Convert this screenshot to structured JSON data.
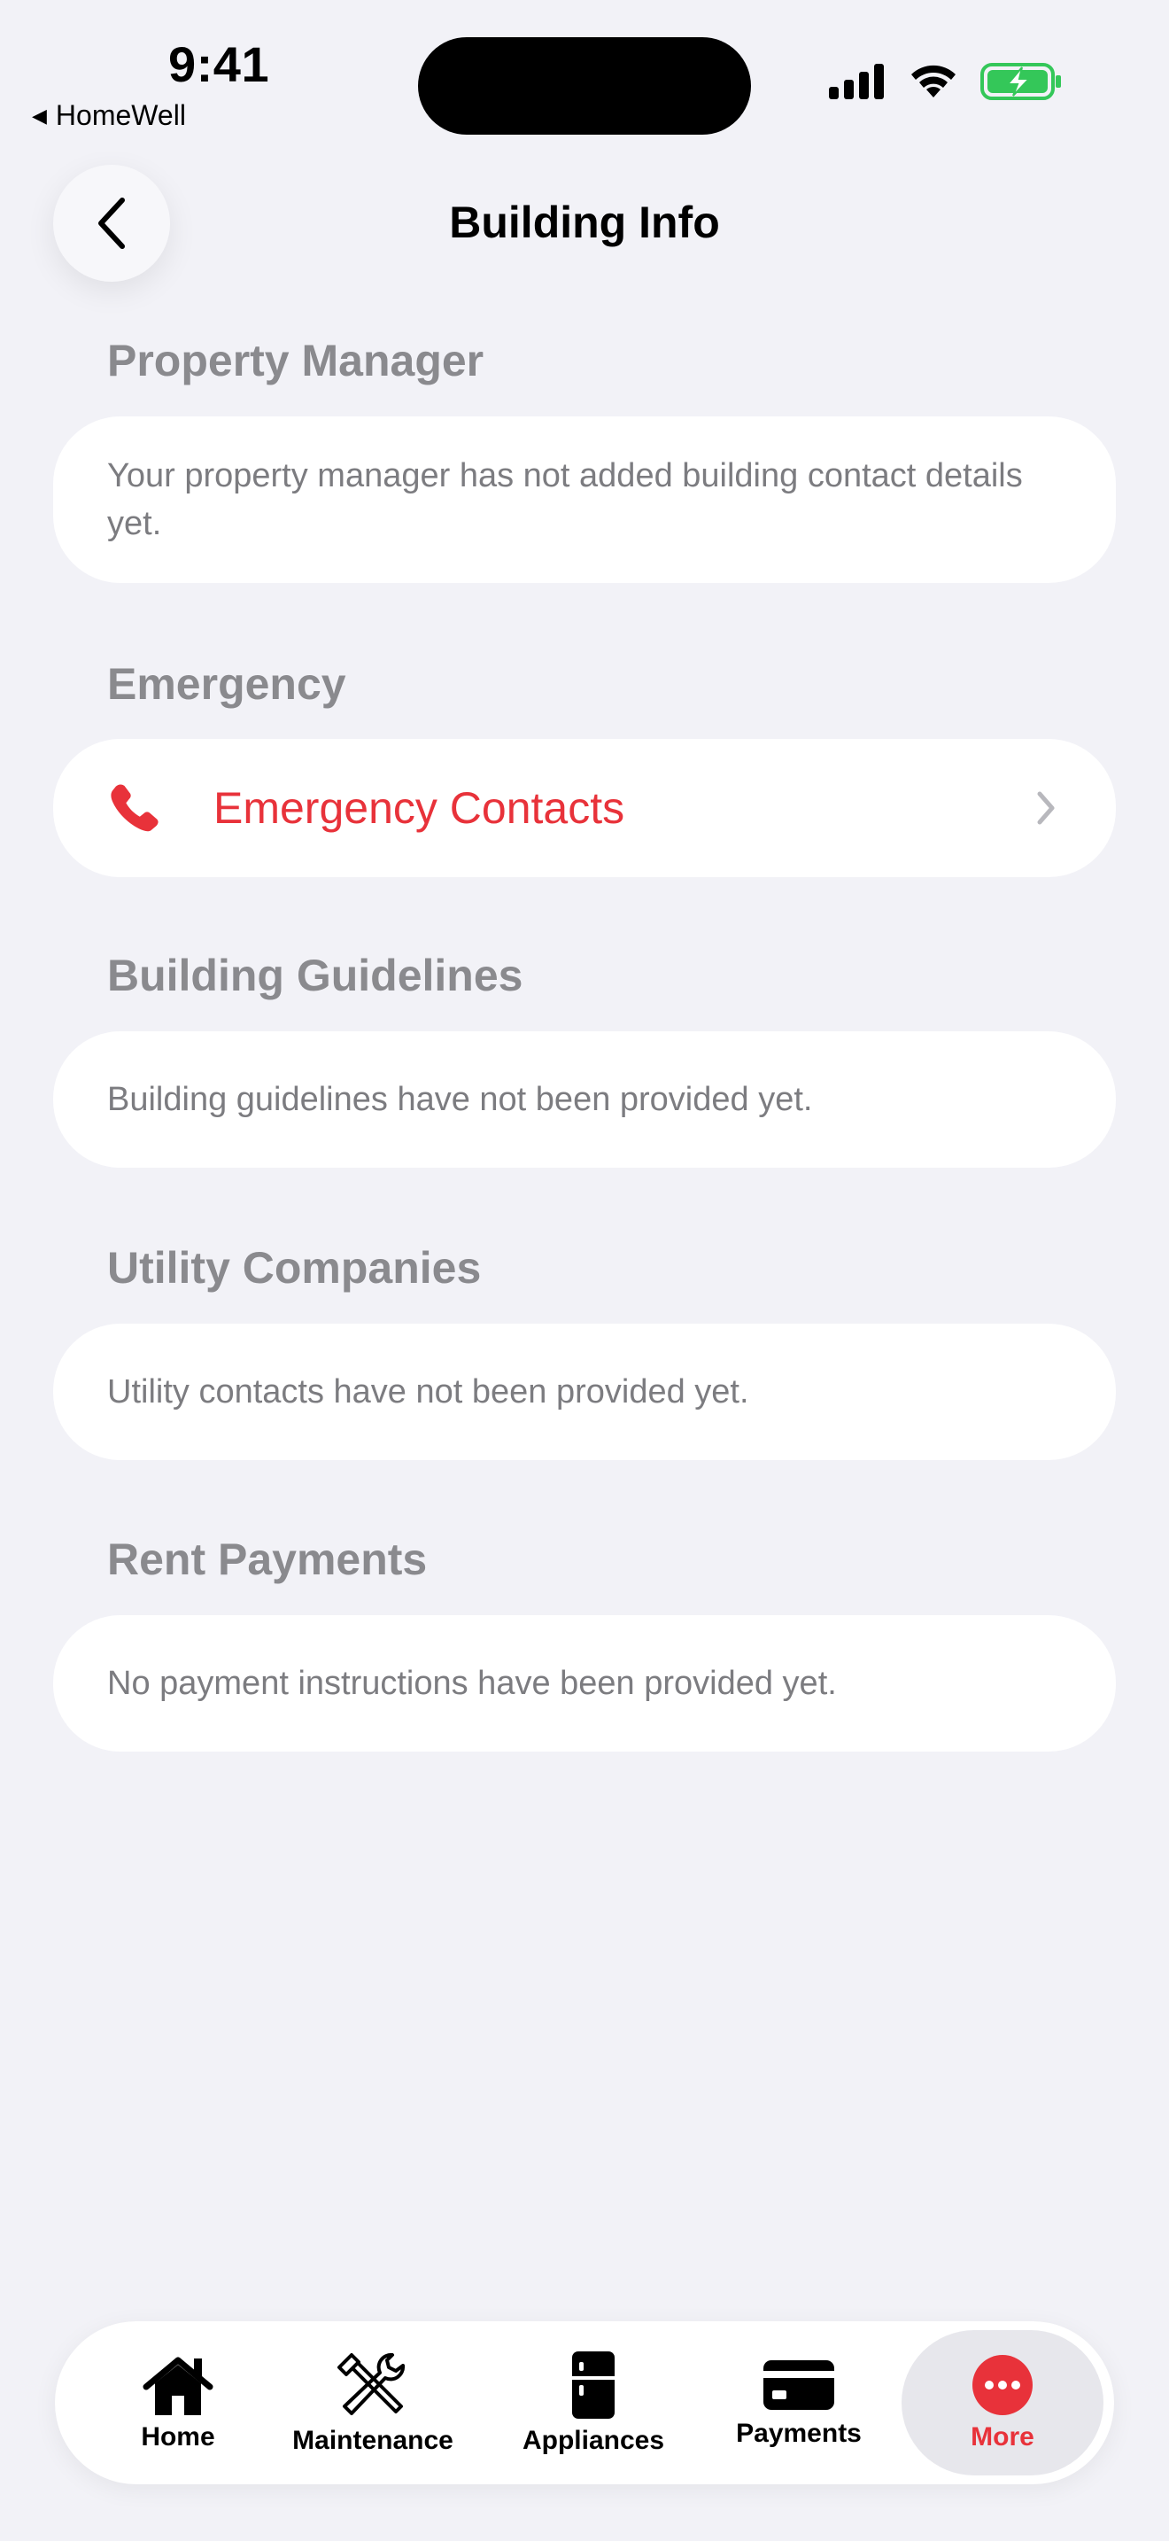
{
  "status_bar": {
    "time": "9:41",
    "back_app": "HomeWell"
  },
  "nav": {
    "title": "Building Info"
  },
  "sections": {
    "property_manager": {
      "header": "Property Manager",
      "text": "Your property manager has not added building contact details yet."
    },
    "emergency": {
      "header": "Emergency",
      "row_label": "Emergency Contacts"
    },
    "building_guidelines": {
      "header": "Building Guidelines",
      "text": "Building guidelines have not been provided yet."
    },
    "utility_companies": {
      "header": "Utility Companies",
      "text": "Utility contacts have not been provided yet."
    },
    "rent_payments": {
      "header": "Rent Payments",
      "text": "No payment instructions have been provided yet."
    }
  },
  "tabbar": {
    "tabs": [
      {
        "label": "Home",
        "icon": "house-icon"
      },
      {
        "label": "Maintenance",
        "icon": "tools-icon"
      },
      {
        "label": "Appliances",
        "icon": "fridge-icon"
      },
      {
        "label": "Payments",
        "icon": "card-icon"
      },
      {
        "label": "More",
        "icon": "ellipsis-circle-icon"
      }
    ],
    "selected": "More"
  },
  "colors": {
    "accent": "#E8323A",
    "background": "#F2F2F7",
    "section_header": "#8A8A8E",
    "secondary_text": "#7C7C80",
    "battery": "#34C759"
  }
}
